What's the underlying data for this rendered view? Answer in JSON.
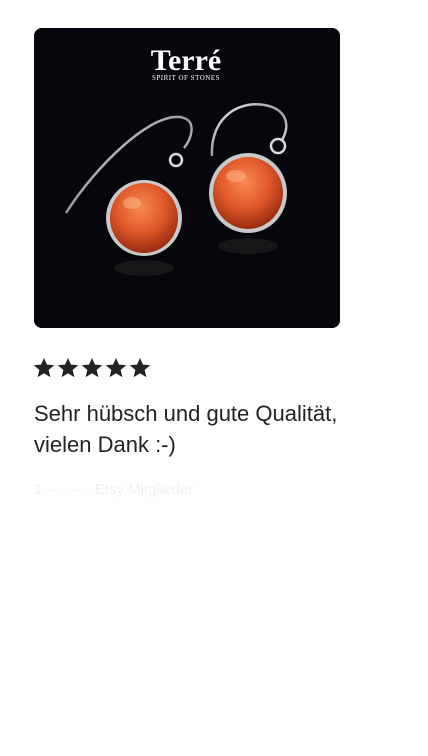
{
  "product": {
    "brand": "Terré",
    "brand_tagline": "SPIRIT OF STONES",
    "image_alt": "orange stone earrings"
  },
  "review": {
    "rating": 5,
    "rating_max": 5,
    "text_line1": "Sehr hübsch und gute Qualität,",
    "text_line2": "vielen Dank :-)",
    "meta": "1 ··· ····· Etsy Mitglieder"
  },
  "colors": {
    "star": "#222222",
    "image_bg": "#05070d",
    "stone": "#e0582a"
  }
}
